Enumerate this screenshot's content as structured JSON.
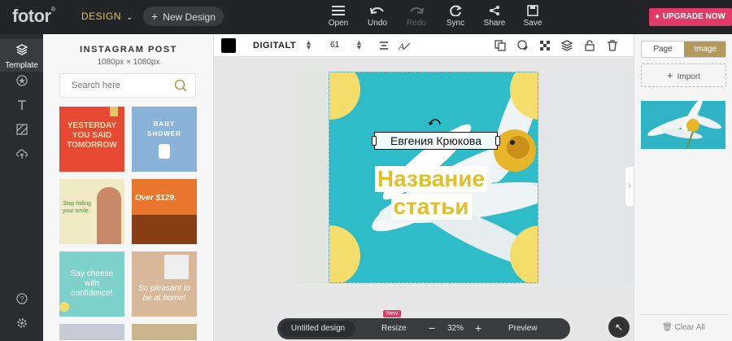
{
  "app": {
    "logo": "fotor",
    "design_menu": "DESIGN",
    "new_design": "New Design",
    "upgrade": "UPGRADE NOW"
  },
  "toolbar": {
    "open": "Open",
    "undo": "Undo",
    "redo": "Redo",
    "sync": "Sync",
    "share": "Share",
    "save": "Save"
  },
  "rail": {
    "template_label": "Template"
  },
  "template_panel": {
    "title": "INSTAGRAM POST",
    "subtitle": "1080px × 1080px",
    "search_placeholder": "Search here",
    "thumbs": [
      {
        "text": "YESTERDAY YOU SAID TOMORROW"
      },
      {
        "text": "BABY SHOWER"
      },
      {
        "text": "Stop hiding your smile"
      },
      {
        "text": "Over $129."
      },
      {
        "text": "Say cheese with confidence!"
      },
      {
        "text": "So pleasant to be at home!"
      }
    ]
  },
  "text_toolbar": {
    "color": "#000000",
    "font": "DIGITALT",
    "size": "61"
  },
  "canvas": {
    "author": "Евгения Крюкова",
    "title_line1": "Название",
    "title_line2": "статьи"
  },
  "bottom_bar": {
    "doc_name": "Untitled design",
    "new_badge": "New",
    "resize": "Resize",
    "zoom": "32%",
    "preview": "Preview"
  },
  "right_panel": {
    "tab_page": "Page",
    "tab_image": "Image",
    "import": "Import",
    "clear_all": "Clear All"
  },
  "colors": {
    "accent_gold": "#b39a5a",
    "upgrade_pink": "#e23a66",
    "canvas_teal": "#2ebcc8",
    "title_yellow": "#e0c02a"
  }
}
